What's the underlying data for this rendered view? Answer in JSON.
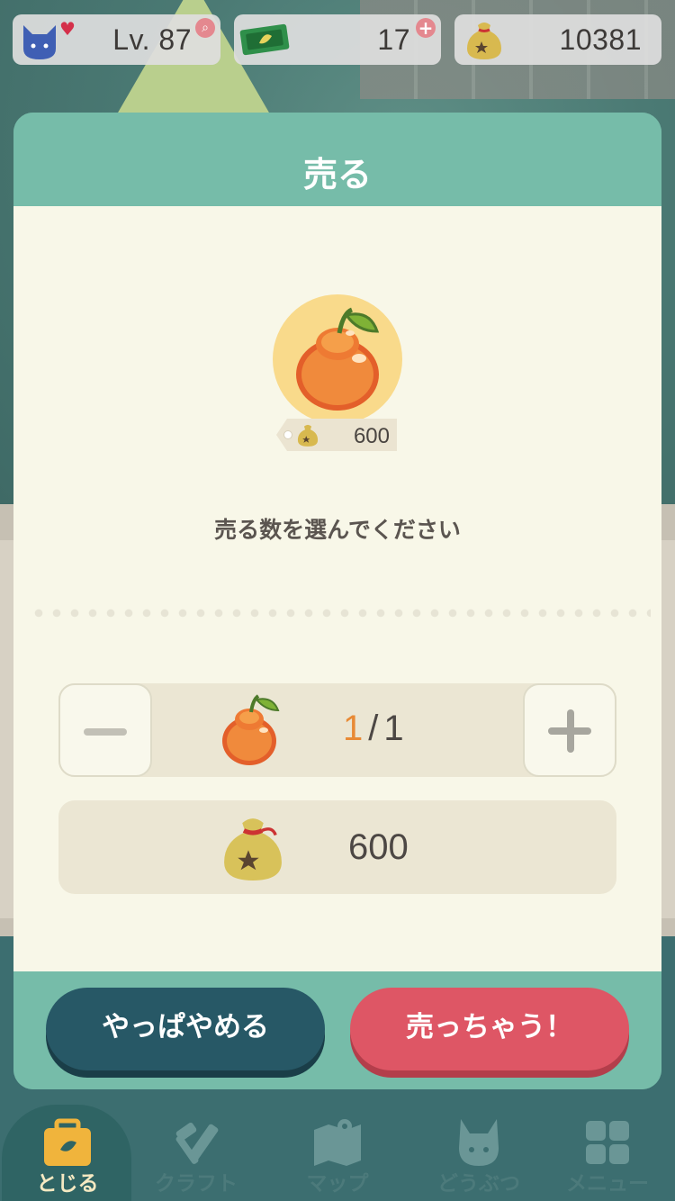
{
  "hud": {
    "level": "Lv. 87",
    "tickets": "17",
    "bells": "10381"
  },
  "modal": {
    "title": "売る",
    "item_price": "600",
    "prompt": "売る数を選んでください",
    "quantity": {
      "current": "1",
      "separator": "/",
      "max": "1"
    },
    "total": "600",
    "cancel_label": "やっぱやめる",
    "sell_label": "売っちゃう！"
  },
  "nav": {
    "items": [
      {
        "label": "とじる",
        "icon": "suitcase-icon"
      },
      {
        "label": "クラフト",
        "icon": "hammer-saw-icon"
      },
      {
        "label": "マップ",
        "icon": "map-icon"
      },
      {
        "label": "どうぶつ",
        "icon": "animal-head-icon"
      },
      {
        "label": "メニュー",
        "icon": "grid-menu-icon"
      }
    ]
  },
  "colors": {
    "header_teal": "#76bca9",
    "body_cream": "#f8f7e8",
    "cancel_button": "#275866",
    "sell_button": "#de5665",
    "quantity_highlight": "#e88a35"
  }
}
